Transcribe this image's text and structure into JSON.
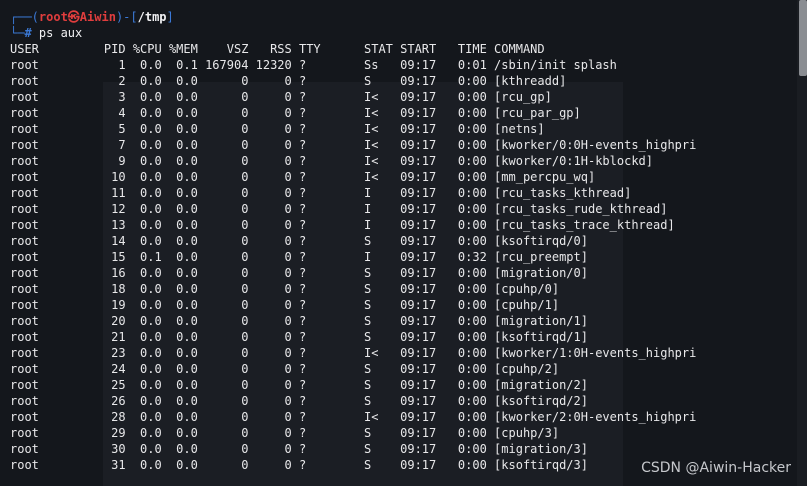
{
  "prompt": {
    "open": "┌──(",
    "userhost": "root㉿Aiwin",
    "close_path_open": ")-[",
    "path": "/tmp",
    "close_path": "]",
    "second_prefix": "└─",
    "hash": "#",
    "command": " ps aux"
  },
  "columns": [
    "USER",
    "PID",
    "%CPU",
    "%MEM",
    "VSZ",
    "RSS",
    "TTY",
    "STAT",
    "START",
    "TIME",
    "COMMAND"
  ],
  "header_line": "USER         PID %CPU %MEM    VSZ   RSS TTY      STAT START   TIME COMMAND",
  "processes": [
    {
      "user": "root",
      "pid": "1",
      "cpu": "0.0",
      "mem": "0.1",
      "vsz": "167904",
      "rss": "12320",
      "tty": "?",
      "stat": "Ss",
      "start": "09:17",
      "time": "0:01",
      "command": "/sbin/init splash"
    },
    {
      "user": "root",
      "pid": "2",
      "cpu": "0.0",
      "mem": "0.0",
      "vsz": "0",
      "rss": "0",
      "tty": "?",
      "stat": "S",
      "start": "09:17",
      "time": "0:00",
      "command": "[kthreadd]"
    },
    {
      "user": "root",
      "pid": "3",
      "cpu": "0.0",
      "mem": "0.0",
      "vsz": "0",
      "rss": "0",
      "tty": "?",
      "stat": "I<",
      "start": "09:17",
      "time": "0:00",
      "command": "[rcu_gp]"
    },
    {
      "user": "root",
      "pid": "4",
      "cpu": "0.0",
      "mem": "0.0",
      "vsz": "0",
      "rss": "0",
      "tty": "?",
      "stat": "I<",
      "start": "09:17",
      "time": "0:00",
      "command": "[rcu_par_gp]"
    },
    {
      "user": "root",
      "pid": "5",
      "cpu": "0.0",
      "mem": "0.0",
      "vsz": "0",
      "rss": "0",
      "tty": "?",
      "stat": "I<",
      "start": "09:17",
      "time": "0:00",
      "command": "[netns]"
    },
    {
      "user": "root",
      "pid": "7",
      "cpu": "0.0",
      "mem": "0.0",
      "vsz": "0",
      "rss": "0",
      "tty": "?",
      "stat": "I<",
      "start": "09:17",
      "time": "0:00",
      "command": "[kworker/0:0H-events_highpri"
    },
    {
      "user": "root",
      "pid": "9",
      "cpu": "0.0",
      "mem": "0.0",
      "vsz": "0",
      "rss": "0",
      "tty": "?",
      "stat": "I<",
      "start": "09:17",
      "time": "0:00",
      "command": "[kworker/0:1H-kblockd]"
    },
    {
      "user": "root",
      "pid": "10",
      "cpu": "0.0",
      "mem": "0.0",
      "vsz": "0",
      "rss": "0",
      "tty": "?",
      "stat": "I<",
      "start": "09:17",
      "time": "0:00",
      "command": "[mm_percpu_wq]"
    },
    {
      "user": "root",
      "pid": "11",
      "cpu": "0.0",
      "mem": "0.0",
      "vsz": "0",
      "rss": "0",
      "tty": "?",
      "stat": "I",
      "start": "09:17",
      "time": "0:00",
      "command": "[rcu_tasks_kthread]"
    },
    {
      "user": "root",
      "pid": "12",
      "cpu": "0.0",
      "mem": "0.0",
      "vsz": "0",
      "rss": "0",
      "tty": "?",
      "stat": "I",
      "start": "09:17",
      "time": "0:00",
      "command": "[rcu_tasks_rude_kthread]"
    },
    {
      "user": "root",
      "pid": "13",
      "cpu": "0.0",
      "mem": "0.0",
      "vsz": "0",
      "rss": "0",
      "tty": "?",
      "stat": "I",
      "start": "09:17",
      "time": "0:00",
      "command": "[rcu_tasks_trace_kthread]"
    },
    {
      "user": "root",
      "pid": "14",
      "cpu": "0.0",
      "mem": "0.0",
      "vsz": "0",
      "rss": "0",
      "tty": "?",
      "stat": "S",
      "start": "09:17",
      "time": "0:00",
      "command": "[ksoftirqd/0]"
    },
    {
      "user": "root",
      "pid": "15",
      "cpu": "0.1",
      "mem": "0.0",
      "vsz": "0",
      "rss": "0",
      "tty": "?",
      "stat": "I",
      "start": "09:17",
      "time": "0:32",
      "command": "[rcu_preempt]"
    },
    {
      "user": "root",
      "pid": "16",
      "cpu": "0.0",
      "mem": "0.0",
      "vsz": "0",
      "rss": "0",
      "tty": "?",
      "stat": "S",
      "start": "09:17",
      "time": "0:00",
      "command": "[migration/0]"
    },
    {
      "user": "root",
      "pid": "18",
      "cpu": "0.0",
      "mem": "0.0",
      "vsz": "0",
      "rss": "0",
      "tty": "?",
      "stat": "S",
      "start": "09:17",
      "time": "0:00",
      "command": "[cpuhp/0]"
    },
    {
      "user": "root",
      "pid": "19",
      "cpu": "0.0",
      "mem": "0.0",
      "vsz": "0",
      "rss": "0",
      "tty": "?",
      "stat": "S",
      "start": "09:17",
      "time": "0:00",
      "command": "[cpuhp/1]"
    },
    {
      "user": "root",
      "pid": "20",
      "cpu": "0.0",
      "mem": "0.0",
      "vsz": "0",
      "rss": "0",
      "tty": "?",
      "stat": "S",
      "start": "09:17",
      "time": "0:00",
      "command": "[migration/1]"
    },
    {
      "user": "root",
      "pid": "21",
      "cpu": "0.0",
      "mem": "0.0",
      "vsz": "0",
      "rss": "0",
      "tty": "?",
      "stat": "S",
      "start": "09:17",
      "time": "0:00",
      "command": "[ksoftirqd/1]"
    },
    {
      "user": "root",
      "pid": "23",
      "cpu": "0.0",
      "mem": "0.0",
      "vsz": "0",
      "rss": "0",
      "tty": "?",
      "stat": "I<",
      "start": "09:17",
      "time": "0:00",
      "command": "[kworker/1:0H-events_highpri"
    },
    {
      "user": "root",
      "pid": "24",
      "cpu": "0.0",
      "mem": "0.0",
      "vsz": "0",
      "rss": "0",
      "tty": "?",
      "stat": "S",
      "start": "09:17",
      "time": "0:00",
      "command": "[cpuhp/2]"
    },
    {
      "user": "root",
      "pid": "25",
      "cpu": "0.0",
      "mem": "0.0",
      "vsz": "0",
      "rss": "0",
      "tty": "?",
      "stat": "S",
      "start": "09:17",
      "time": "0:00",
      "command": "[migration/2]"
    },
    {
      "user": "root",
      "pid": "26",
      "cpu": "0.0",
      "mem": "0.0",
      "vsz": "0",
      "rss": "0",
      "tty": "?",
      "stat": "S",
      "start": "09:17",
      "time": "0:00",
      "command": "[ksoftirqd/2]"
    },
    {
      "user": "root",
      "pid": "28",
      "cpu": "0.0",
      "mem": "0.0",
      "vsz": "0",
      "rss": "0",
      "tty": "?",
      "stat": "I<",
      "start": "09:17",
      "time": "0:00",
      "command": "[kworker/2:0H-events_highpri"
    },
    {
      "user": "root",
      "pid": "29",
      "cpu": "0.0",
      "mem": "0.0",
      "vsz": "0",
      "rss": "0",
      "tty": "?",
      "stat": "S",
      "start": "09:17",
      "time": "0:00",
      "command": "[cpuhp/3]"
    },
    {
      "user": "root",
      "pid": "30",
      "cpu": "0.0",
      "mem": "0.0",
      "vsz": "0",
      "rss": "0",
      "tty": "?",
      "stat": "S",
      "start": "09:17",
      "time": "0:00",
      "command": "[migration/3]"
    },
    {
      "user": "root",
      "pid": "31",
      "cpu": "0.0",
      "mem": "0.0",
      "vsz": "0",
      "rss": "0",
      "tty": "?",
      "stat": "S",
      "start": "09:17",
      "time": "0:00",
      "command": "[ksoftirqd/3]"
    }
  ],
  "watermark": "CSDN @Aiwin-Hacker",
  "colors": {
    "background": "#14171c",
    "prompt_bracket": "#3b79d6",
    "prompt_userhost": "#e03d3d",
    "text": "#e8e8ea",
    "scroll_thumb": "#8a8d92"
  }
}
